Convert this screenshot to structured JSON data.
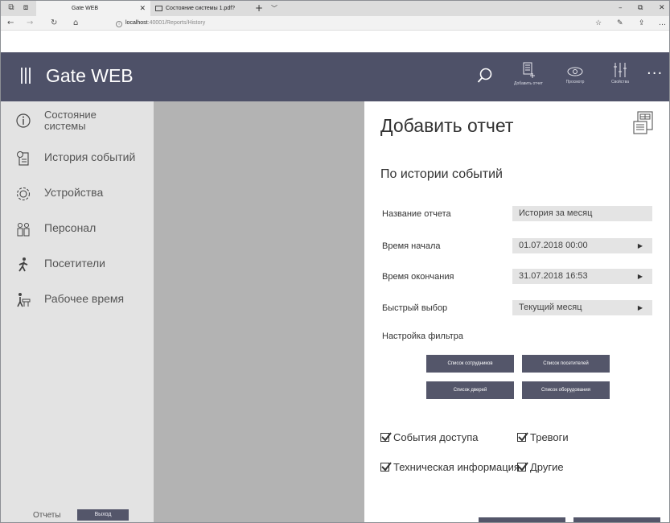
{
  "browser": {
    "tabs": [
      {
        "title": "Gate WEB"
      },
      {
        "title": "Состояние системы 1.pdf?"
      }
    ],
    "url_host": "localhost",
    "url_rest": ":40001/Reports/History"
  },
  "app": {
    "title": "Gate WEB",
    "header_buttons": [
      {
        "label": "Добавить отчет",
        "icon": "add-report-icon"
      },
      {
        "label": "Просмотр",
        "icon": "eye-icon"
      },
      {
        "label": "Свойства",
        "icon": "sliders-icon"
      }
    ]
  },
  "sidebar": {
    "items": [
      {
        "label": "Состояние системы",
        "label_line1": "Состояние",
        "label_line2": "системы",
        "icon": "info-circle-icon"
      },
      {
        "label": "История событий",
        "icon": "history-icon"
      },
      {
        "label": "Устройства",
        "icon": "gear-icon"
      },
      {
        "label": "Персонал",
        "icon": "people-icon"
      },
      {
        "label": "Посетители",
        "icon": "walking-person-icon"
      },
      {
        "label": "Рабочее время",
        "icon": "work-time-icon"
      }
    ],
    "footer_label": "Отчеты",
    "logout_label": "Выход"
  },
  "panel": {
    "title": "Добавить отчет",
    "subtitle": "По истории событий",
    "fields": [
      {
        "label": "Название отчета",
        "value": "История за месяц",
        "has_arrow": false
      },
      {
        "label": "Время начала",
        "value": "01.07.2018 00:00",
        "has_arrow": true
      },
      {
        "label": "Время окончания",
        "value": "31.07.2018 16:53",
        "has_arrow": true
      },
      {
        "label": "Быстрый выбор",
        "value": "Текущий месяц",
        "has_arrow": true
      }
    ],
    "filter_label": "Настройка фильтра",
    "filter_buttons": [
      "Список сотрудников",
      "Список посетителей",
      "Список дверей",
      "Список оборудования"
    ],
    "checkboxes": [
      {
        "label": "События доступа",
        "checked": true
      },
      {
        "label": "Тревоги",
        "checked": true
      },
      {
        "label": "Техническая информация",
        "checked": true
      },
      {
        "label": "Другие",
        "checked": true
      }
    ]
  },
  "colors": {
    "header_bg": "#4e5168",
    "button_bg": "#54566a",
    "sidebar_bg": "#e3e3e3",
    "overlay_bg": "#b3b3b3",
    "field_bg": "#e4e4e4"
  }
}
